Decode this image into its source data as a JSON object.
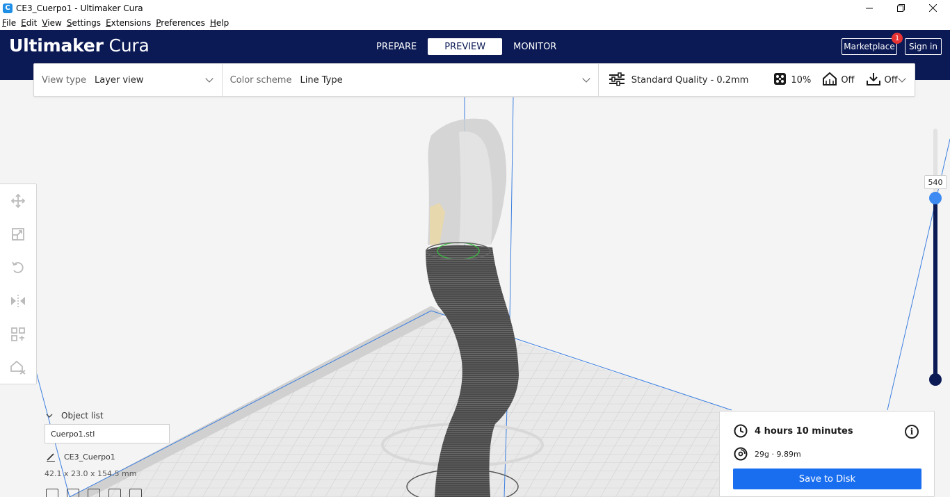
{
  "window": {
    "title": "CE3_Cuerpo1 - Ultimaker Cura",
    "app_icon_glyph": "C",
    "controls": [
      "minimize-icon",
      "restore-icon",
      "close-icon"
    ]
  },
  "menu": [
    "File",
    "Edit",
    "View",
    "Settings",
    "Extensions",
    "Preferences",
    "Help"
  ],
  "header": {
    "brand_bold": "Ultimaker",
    "brand_light": "Cura",
    "tabs": [
      "PREPARE",
      "PREVIEW",
      "MONITOR"
    ],
    "active_tab": "PREVIEW",
    "marketplace_label": "Marketplace",
    "marketplace_badge": "1",
    "signin_label": "Sign in",
    "bg_color": "#0b1a55"
  },
  "toolbar": {
    "view_type_label": "View type",
    "view_type_value": "Layer view",
    "color_scheme_label": "Color scheme",
    "color_scheme_value": "Line Type",
    "quality": "Standard Quality - 0.2mm",
    "infill": "10%",
    "support": "Off",
    "adhesion": "Off"
  },
  "tools": [
    "move-icon",
    "scale-icon",
    "rotate-icon",
    "mirror-icon",
    "per-model-settings-icon",
    "support-blocker-icon"
  ],
  "object_list": {
    "header": "Object list",
    "file": "Cuerpo1.stl",
    "name": "CE3_Cuerpo1",
    "dimensions": "42.1 x 23.0 x 154.5 mm"
  },
  "layer_slider": {
    "value": "540"
  },
  "print_info": {
    "time": "4 hours 10 minutes",
    "material": "29g · 9.89m",
    "save_label": "Save to Disk",
    "accent_color": "#196ef0"
  }
}
